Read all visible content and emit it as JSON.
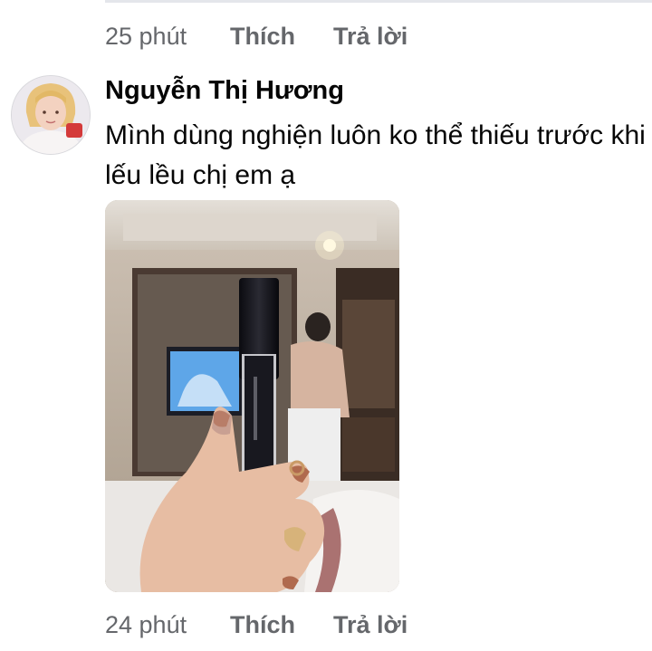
{
  "previous_comment": {
    "time": "25 phút",
    "like_label": "Thích",
    "reply_label": "Trả lời"
  },
  "comment": {
    "author": "Nguyễn Thị Hương",
    "text": "Mình dùng nghiện luôn ko thể thiếu trước khi lếu lều chị em ạ",
    "time": "24 phút",
    "like_label": "Thích",
    "reply_label": "Trả lời"
  },
  "colors": {
    "meta_text": "#65676b",
    "primary_text": "#050505",
    "divider": "#e4e6eb"
  }
}
